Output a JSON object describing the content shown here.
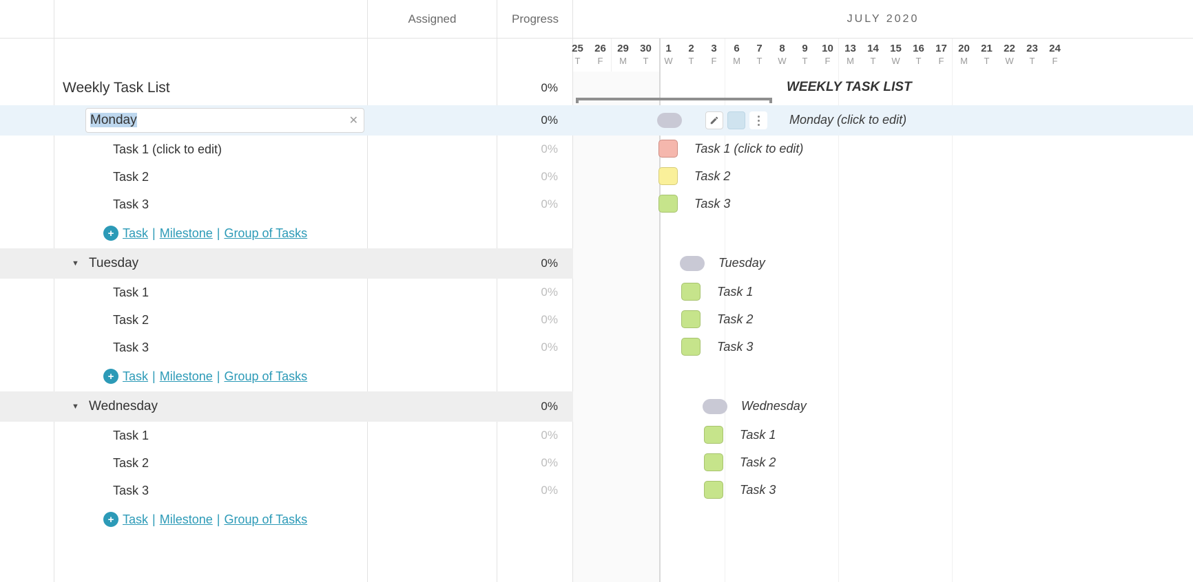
{
  "header": {
    "assigned_label": "Assigned",
    "progress_label": "Progress",
    "month_label": "JULY 2020"
  },
  "list_title": "Weekly Task List",
  "list_progress": "0%",
  "timeline_title": "WEEKLY TASK LIST",
  "selected_group_label_timeline": "Monday (click to edit)",
  "editbox_value": "Monday",
  "days": [
    {
      "num": "25",
      "wk": "T"
    },
    {
      "num": "26",
      "wk": "F"
    },
    {
      "num": "29",
      "wk": "M"
    },
    {
      "num": "30",
      "wk": "T"
    },
    {
      "num": "1",
      "wk": "W"
    },
    {
      "num": "2",
      "wk": "T"
    },
    {
      "num": "3",
      "wk": "F"
    },
    {
      "num": "6",
      "wk": "M"
    },
    {
      "num": "7",
      "wk": "T"
    },
    {
      "num": "8",
      "wk": "W"
    },
    {
      "num": "9",
      "wk": "T"
    },
    {
      "num": "10",
      "wk": "F"
    },
    {
      "num": "13",
      "wk": "M"
    },
    {
      "num": "14",
      "wk": "T"
    },
    {
      "num": "15",
      "wk": "W"
    },
    {
      "num": "16",
      "wk": "T"
    },
    {
      "num": "17",
      "wk": "F"
    },
    {
      "num": "20",
      "wk": "M"
    },
    {
      "num": "21",
      "wk": "T"
    },
    {
      "num": "22",
      "wk": "W"
    },
    {
      "num": "23",
      "wk": "T"
    },
    {
      "num": "24",
      "wk": "F"
    }
  ],
  "add_labels": {
    "task": "Task",
    "milestone": "Milestone",
    "group": "Group of Tasks"
  },
  "groups": [
    {
      "name": "Monday",
      "editing": true,
      "progress": "0%",
      "tasks": [
        {
          "name": "Task 1 (click to edit)",
          "progress": "0%",
          "timeline_label": "Task 1 (click to edit)",
          "color": "red"
        },
        {
          "name": "Task 2",
          "progress": "0%",
          "timeline_label": "Task 2",
          "color": "yellow"
        },
        {
          "name": "Task 3",
          "progress": "0%",
          "timeline_label": "Task 3",
          "color": "green"
        }
      ],
      "timeline_label": "Monday (click to edit)"
    },
    {
      "name": "Tuesday",
      "progress": "0%",
      "timeline_label": "Tuesday",
      "tasks": [
        {
          "name": "Task 1",
          "progress": "0%",
          "timeline_label": "Task 1",
          "color": "green"
        },
        {
          "name": "Task 2",
          "progress": "0%",
          "timeline_label": "Task 2",
          "color": "green"
        },
        {
          "name": "Task 3",
          "progress": "0%",
          "timeline_label": "Task 3",
          "color": "green"
        }
      ]
    },
    {
      "name": "Wednesday",
      "progress": "0%",
      "timeline_label": "Wednesday",
      "tasks": [
        {
          "name": "Task 1",
          "progress": "0%",
          "timeline_label": "Task 1",
          "color": "green"
        },
        {
          "name": "Task 2",
          "progress": "0%",
          "timeline_label": "Task 2",
          "color": "green"
        },
        {
          "name": "Task 3",
          "progress": "0%",
          "timeline_label": "Task 3",
          "color": "green"
        }
      ]
    }
  ]
}
